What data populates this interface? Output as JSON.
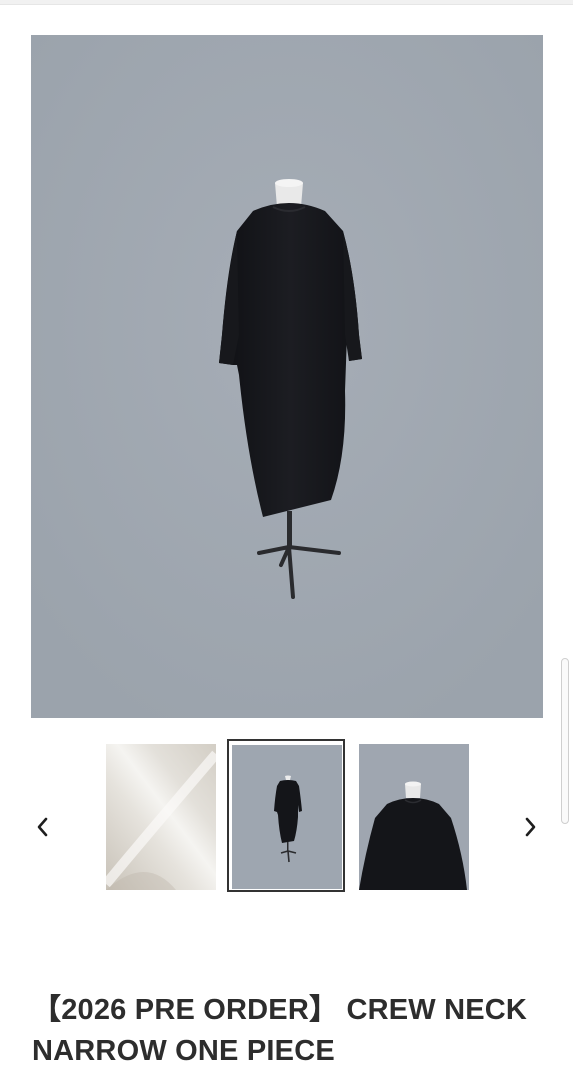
{
  "product": {
    "title": "【2026 PRE ORDER】 CREW NECK NARROW ONE PIECE",
    "main_image": {
      "alt": "CREW NECK NARROW ONE PIECE",
      "background_color": "#a1a8b1",
      "garment_color": "#141519"
    },
    "gallery": {
      "prev_icon": "chevron-left-icon",
      "next_icon": "chevron-right-icon",
      "thumbnails": [
        {
          "alt": "fabric detail"
        },
        {
          "alt": "full length front"
        },
        {
          "alt": "upper body front"
        }
      ],
      "selected_index": 1
    }
  },
  "colors": {
    "selected_border": "#333333",
    "title": "#2d2d2d"
  }
}
